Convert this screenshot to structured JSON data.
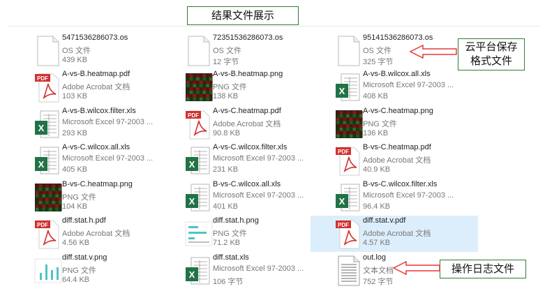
{
  "title": "结果文件展示",
  "callouts": {
    "cloud_line1": "云平台保存",
    "cloud_line2": "格式文件",
    "log": "操作日志文件"
  },
  "colors": {
    "callout_border": "#2e7d32",
    "arrow": "#e53935",
    "selection": "#dceefb",
    "pdf_red": "#d32f2f",
    "excel_green": "#217346"
  },
  "files": [
    {
      "name": "5471536286073.os",
      "type": "OS 文件",
      "size": "439 KB",
      "icon": "blank-file-icon"
    },
    {
      "name": "72351536286073.os",
      "type": "OS 文件",
      "size": "12 字节",
      "icon": "blank-file-icon"
    },
    {
      "name": "95141536286073.os",
      "type": "OS 文件",
      "size": "325 字节",
      "icon": "blank-file-icon"
    },
    {
      "name": "A-vs-B.heatmap.pdf",
      "type": "Adobe Acrobat 文档",
      "size": "103 KB",
      "icon": "pdf-icon"
    },
    {
      "name": "A-vs-B.heatmap.png",
      "type": "PNG 文件",
      "size": "138 KB",
      "icon": "heatmap-thumbnail"
    },
    {
      "name": "A-vs-B.wilcox.all.xls",
      "type": "Microsoft Excel 97-2003 ...",
      "size": "408 KB",
      "icon": "excel-icon"
    },
    {
      "name": "A-vs-B.wilcox.filter.xls",
      "type": "Microsoft Excel 97-2003 ...",
      "size": "293 KB",
      "icon": "excel-icon"
    },
    {
      "name": "A-vs-C.heatmap.pdf",
      "type": "Adobe Acrobat 文档",
      "size": "90.8 KB",
      "icon": "pdf-icon"
    },
    {
      "name": "A-vs-C.heatmap.png",
      "type": "PNG 文件",
      "size": "136 KB",
      "icon": "heatmap-thumbnail"
    },
    {
      "name": "A-vs-C.wilcox.all.xls",
      "type": "Microsoft Excel 97-2003 ...",
      "size": "405 KB",
      "icon": "excel-icon"
    },
    {
      "name": "A-vs-C.wilcox.filter.xls",
      "type": "Microsoft Excel 97-2003 ...",
      "size": "231 KB",
      "icon": "excel-icon"
    },
    {
      "name": "B-vs-C.heatmap.pdf",
      "type": "Adobe Acrobat 文档",
      "size": "40.9 KB",
      "icon": "pdf-icon"
    },
    {
      "name": "B-vs-C.heatmap.png",
      "type": "PNG 文件",
      "size": "104 KB",
      "icon": "heatmap-thumbnail"
    },
    {
      "name": "B-vs-C.wilcox.all.xls",
      "type": "Microsoft Excel 97-2003 ...",
      "size": "401 KB",
      "icon": "excel-icon"
    },
    {
      "name": "B-vs-C.wilcox.filter.xls",
      "type": "Microsoft Excel 97-2003 ...",
      "size": "96.4 KB",
      "icon": "excel-icon"
    },
    {
      "name": "diff.stat.h.pdf",
      "type": "Adobe Acrobat 文档",
      "size": "4.56 KB",
      "icon": "pdf-icon"
    },
    {
      "name": "diff.stat.h.png",
      "type": "PNG 文件",
      "size": "71.2 KB",
      "icon": "hbar-thumbnail"
    },
    {
      "name": "diff.stat.v.pdf",
      "type": "Adobe Acrobat 文档",
      "size": "4.57 KB",
      "icon": "pdf-icon",
      "selected": true
    },
    {
      "name": "diff.stat.v.png",
      "type": "PNG 文件",
      "size": "64.4 KB",
      "icon": "vbar-thumbnail"
    },
    {
      "name": "diff.stat.xls",
      "type": "Microsoft Excel 97-2003 ...",
      "size": "106 字节",
      "icon": "excel-icon"
    },
    {
      "name": "out.log",
      "type": "文本文档",
      "size": "752 字节",
      "icon": "text-file-icon"
    }
  ]
}
